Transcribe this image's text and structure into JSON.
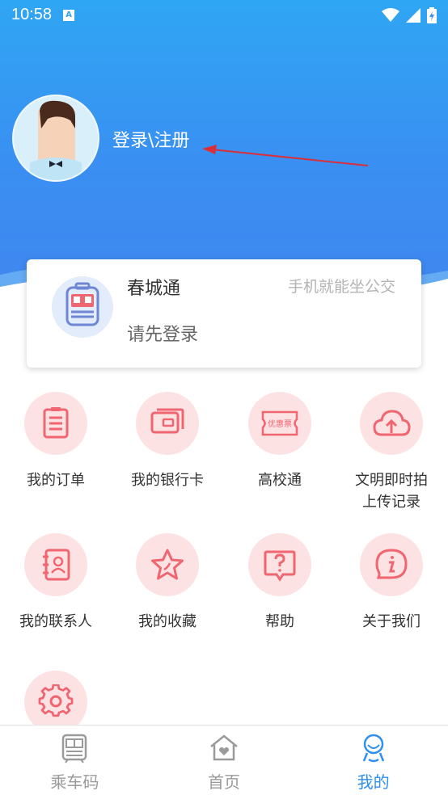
{
  "status_bar": {
    "time": "10:58",
    "notification_letter": "A"
  },
  "profile": {
    "login_text": "登录\\注册"
  },
  "card": {
    "title": "春城通",
    "slogan": "手机就能坐公交",
    "subtitle": "请先登录"
  },
  "grid": {
    "items": [
      {
        "label": "我的订单",
        "icon": "order-icon"
      },
      {
        "label": "我的银行卡",
        "icon": "bank-card-icon"
      },
      {
        "label": "高校通",
        "icon": "coupon-ticket-icon",
        "icon_text": "优惠票"
      },
      {
        "label": "文明即时拍",
        "label2": "上传记录",
        "icon": "upload-cloud-icon"
      },
      {
        "label": "我的联系人",
        "icon": "contact-book-icon"
      },
      {
        "label": "我的收藏",
        "icon": "star-icon"
      },
      {
        "label": "帮助",
        "icon": "help-icon"
      },
      {
        "label": "关于我们",
        "icon": "info-icon"
      },
      {
        "label": "",
        "icon": "settings-gear-icon"
      }
    ]
  },
  "bottom_nav": {
    "items": [
      {
        "label": "乘车码",
        "icon": "bus-code-icon",
        "active": false
      },
      {
        "label": "首页",
        "icon": "home-icon",
        "active": false
      },
      {
        "label": "我的",
        "icon": "profile-icon",
        "active": true
      }
    ]
  },
  "colors": {
    "header_blue": "#3a8ff2",
    "accent_red": "#f06670",
    "icon_bg_pink": "#fde2e3",
    "active_nav": "#2f8ff0"
  }
}
